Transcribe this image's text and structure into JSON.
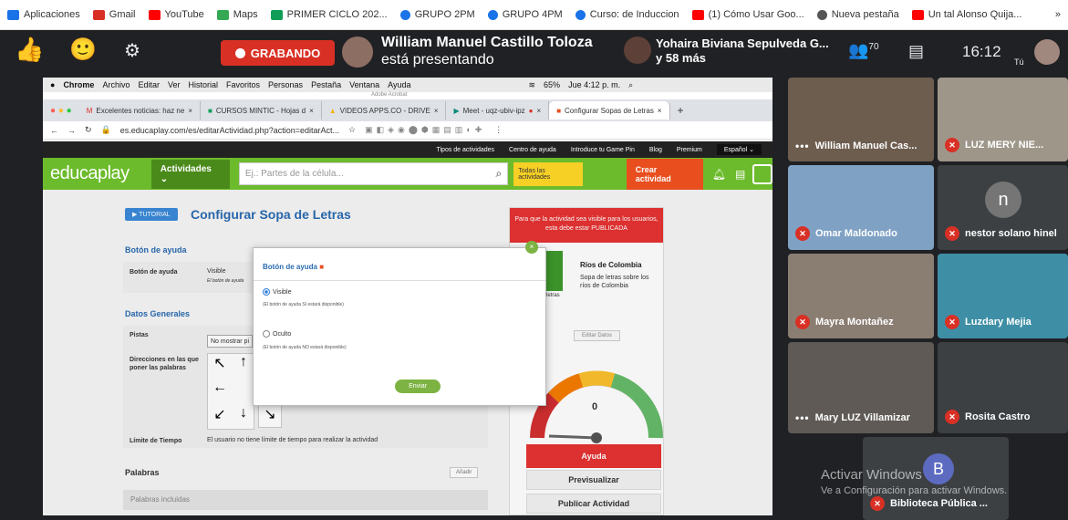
{
  "bookmarks": [
    {
      "label": "Aplicaciones",
      "icon": "apps-grid-icon",
      "color": "#1a73e8"
    },
    {
      "label": "Gmail",
      "icon": "gmail-icon",
      "color": "#d93025"
    },
    {
      "label": "YouTube",
      "icon": "youtube-icon",
      "color": "#ff0000"
    },
    {
      "label": "Maps",
      "icon": "maps-icon",
      "color": "#34a853"
    },
    {
      "label": "PRIMER CICLO 202...",
      "icon": "sheets-icon",
      "color": "#0f9d58"
    },
    {
      "label": "GRUPO 2PM",
      "icon": "info-icon",
      "color": "#1a73e8"
    },
    {
      "label": "GRUPO 4PM",
      "icon": "info-icon",
      "color": "#1a73e8"
    },
    {
      "label": "Curso: de Induccion",
      "icon": "info-icon",
      "color": "#1a73e8"
    },
    {
      "label": "(1) Cómo Usar Goo...",
      "icon": "youtube-icon",
      "color": "#ff0000"
    },
    {
      "label": "Nueva pestaña",
      "icon": "globe-icon",
      "color": "#555555"
    },
    {
      "label": "Un tal Alonso Quija...",
      "icon": "youtube-icon",
      "color": "#ff0000"
    }
  ],
  "bookmarks_more": "»",
  "meet": {
    "recording_label": "GRABANDO",
    "presenter_line1": "William Manuel Castillo Toloza",
    "presenter_line2": "está presentando",
    "other_name": "Yohaira Biviana Sepulveda G...",
    "other_more": "y 58 más",
    "participants_count": "70",
    "time": "16:12",
    "you_label": "Tú"
  },
  "mac_menu": {
    "items": [
      "Chrome",
      "Archivo",
      "Editar",
      "Ver",
      "Historial",
      "Favoritos",
      "Personas",
      "Pestaña",
      "Ventana",
      "Ayuda"
    ],
    "status": "65%",
    "datetime": "Jue 4:12 p. m.",
    "subtitle": "Adobe Acrobat"
  },
  "chrome_tabs": [
    {
      "label": "Excelentes noticias: haz ne",
      "icon": "gmail-icon"
    },
    {
      "label": "CURSOS MINTIC - Hojas d",
      "icon": "sheets-icon"
    },
    {
      "label": "VIDEOS APPS.CO - DRIVE",
      "icon": "drive-icon"
    },
    {
      "label": "Meet - uqz-ubiv-ipz",
      "icon": "meet-icon"
    },
    {
      "label": "Configurar Sopas de Letras",
      "icon": "educaplay-icon"
    }
  ],
  "url": "es.educaplay.com/es/editarActividad.php?action=editarAct...",
  "topnav": [
    "Tipos de actividades",
    "Centro de ayuda",
    "Introduce tu Game Pin",
    "Blog",
    "Premium"
  ],
  "lang": "Español",
  "educaplay": {
    "logo": "educaplay",
    "actividades": "Actividades",
    "search_placeholder": "Ej.: Partes de la célula...",
    "todas": "Todas las actividades",
    "crear": "Crear actividad"
  },
  "page": {
    "tutorial": "TUTORIAL",
    "title": "Configurar Sopa de Letras",
    "boton_ayuda_section": "Botón de ayuda",
    "boton_ayuda_label": "Botón de ayuda",
    "boton_ayuda_value": "Visible",
    "boton_ayuda_note": "El botón de ayuda",
    "datos_generales": "Datos Generales",
    "pistas_label": "Pistas",
    "pistas_value": "No mostrar pi",
    "direcciones_label": "Direcciones en las que poner las palabras",
    "limite_label": "Límite de Tiempo",
    "limite_value": "El usuario no tiene límite de tiempo para realizar la actividad",
    "palabras": "Palabras",
    "anadir": "Añadir",
    "palabras_incluidas": "Palabras incluidas"
  },
  "side_panel": {
    "notice": "Para que la actividad sea visible para los usuarios, esta debe estar PUBLICADA",
    "activity_title": "Ríos de Colombia",
    "activity_desc": "Sopa de letras sobre los ríos de Colombia",
    "thumb_label": "letras",
    "editar": "Editar Datos",
    "gauge_value": "0",
    "ayuda": "Ayuda",
    "previsualizar": "Previsualizar",
    "publicar": "Publicar Actividad"
  },
  "modal": {
    "title": "Botón de ayuda",
    "visible": "Visible",
    "visible_note": "(El botón de ayuda SI estará disponible)",
    "oculto": "Oculto",
    "oculto_note": "(El botón de ayuda NO estará disponible)",
    "enviar": "Enviar"
  },
  "participants": [
    {
      "name": "William Manuel Cas...",
      "muted": false
    },
    {
      "name": "LUZ MERY NIE...",
      "muted": true
    },
    {
      "name": "Omar Maldonado",
      "muted": true
    },
    {
      "name": "nestor solano hinel",
      "muted": true,
      "initial": "n"
    },
    {
      "name": "Mayra Montañez",
      "muted": true
    },
    {
      "name": "Luzdary Mejia",
      "muted": true
    },
    {
      "name": "Mary LUZ Villamizar",
      "muted": false
    },
    {
      "name": "Rosita Castro",
      "muted": true
    },
    {
      "name": "Biblioteca Pública ...",
      "muted": true,
      "initial": "B"
    }
  ],
  "watermark": {
    "line1": "Activar Windows",
    "line2": "Ve a Configuración para activar Windows."
  }
}
